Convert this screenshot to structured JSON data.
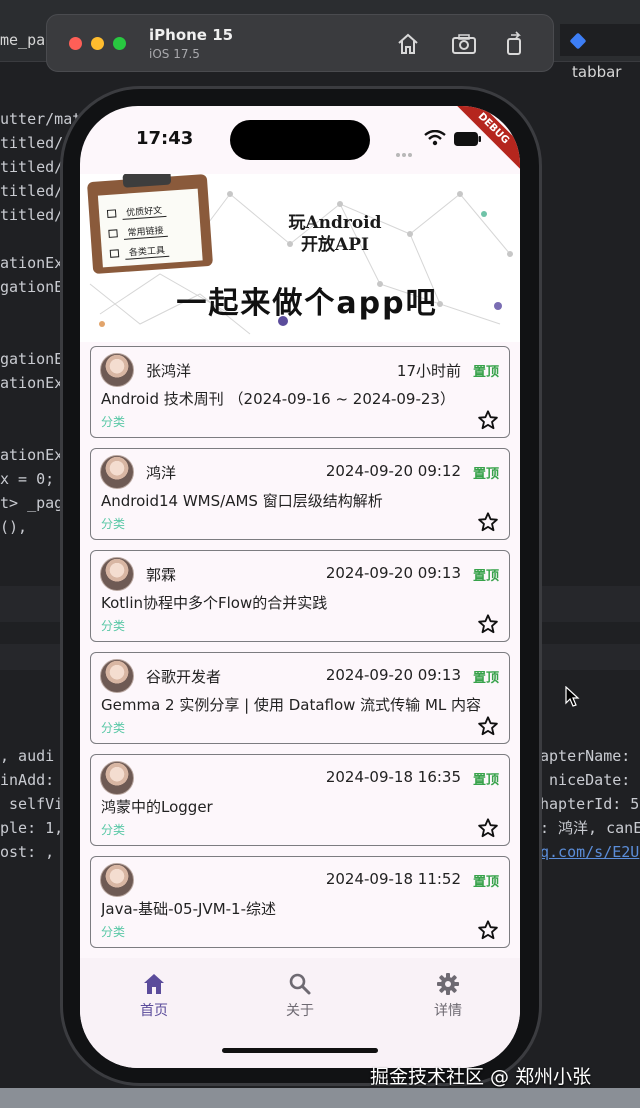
{
  "simulator": {
    "device": "iPhone 15",
    "os": "iOS 17.5"
  },
  "ide": {
    "left_tab": "me_pag",
    "right_tab": "tabbar",
    "code_lines_left": [
      "utter/mat",
      "titled/",
      "titled/",
      "titled/",
      "titled/",
      "",
      "ationExa",
      "gationE",
      "",
      "",
      "gationE",
      "ationEx",
      "",
      "",
      "ationEx",
      "x = 0;",
      "t> _pag",
      "(),"
    ],
    "code_lines_lower_left": [
      ", audi",
      "inAdd:",
      " selfVi",
      "ple: 1,",
      "ost: ,"
    ],
    "code_lines_lower_right": [
      "apterName:",
      " niceDate:",
      "hapterId: 5",
      ": 鸿洋, canE",
      "q.com/s/E2U"
    ]
  },
  "status_bar": {
    "time": "17:43",
    "debug_label": "DEBUG"
  },
  "banner": {
    "title_line1": "玩Android",
    "title_line2": "开放API",
    "slogan": "一起来做个app吧",
    "clipboard_items": [
      "优质好文",
      "常用链接",
      "各类工具"
    ]
  },
  "articles": [
    {
      "author": "张鸿洋",
      "date": "17小时前",
      "tag": "置顶",
      "title": "Android 技术周刊 （2024-09-16 ~ 2024-09-23）",
      "category": "分类"
    },
    {
      "author": "鸿洋",
      "date": "2024-09-20 09:12",
      "tag": "置顶",
      "title": "Android14 WMS/AMS 窗口层级结构解析",
      "category": "分类"
    },
    {
      "author": "郭霖",
      "date": "2024-09-20 09:13",
      "tag": "置顶",
      "title": "Kotlin协程中多个Flow的合并实践",
      "category": "分类"
    },
    {
      "author": "谷歌开发者",
      "date": "2024-09-20 09:13",
      "tag": "置顶",
      "title": "Gemma 2 实例分享 | 使用 Dataflow 流式传输 ML 内容",
      "category": "分类"
    },
    {
      "author": "",
      "date": "2024-09-18 16:35",
      "tag": "置顶",
      "title": "鸿蒙中的Logger",
      "category": "分类"
    },
    {
      "author": "",
      "date": "2024-09-18 11:52",
      "tag": "置顶",
      "title": "Java-基础-05-JVM-1-综述",
      "category": "分类"
    }
  ],
  "bottom_nav": {
    "items": [
      {
        "label": "首页",
        "icon": "home-icon",
        "active": true
      },
      {
        "label": "关于",
        "icon": "search-icon",
        "active": false
      },
      {
        "label": "详情",
        "icon": "gear-icon",
        "active": false
      }
    ],
    "active_color": "#5b4c9b",
    "inactive_color": "#6e6a72"
  },
  "colors": {
    "top_tag": "#37a24a",
    "category": "#59c8a6",
    "screen_bg": "#fdf7fb"
  },
  "watermark": "掘金技术社区 @ 郑州小张"
}
